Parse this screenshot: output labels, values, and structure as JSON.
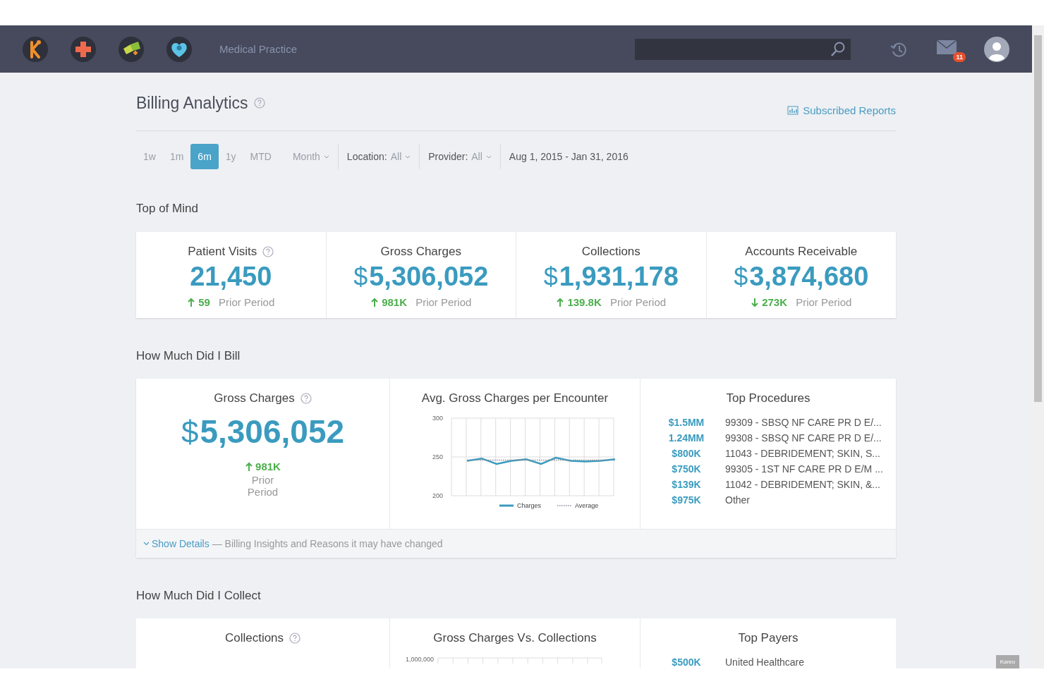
{
  "header": {
    "apps": [
      {
        "kind": "figure"
      },
      {
        "kind": "cross"
      },
      {
        "kind": "cards"
      },
      {
        "kind": "heart"
      }
    ],
    "practice": "Medical Practice",
    "mail_badge": "11"
  },
  "page": {
    "title": "Billing Analytics",
    "subscribed": "Subscribed Reports"
  },
  "filters": {
    "periods": [
      {
        "label": "1w",
        "selected": false
      },
      {
        "label": "1m",
        "selected": false
      },
      {
        "label": "6m",
        "selected": true
      },
      {
        "label": "1y",
        "selected": false
      },
      {
        "label": "MTD",
        "selected": false
      }
    ],
    "interval": "Month",
    "location": {
      "label": "Location:",
      "value": "All"
    },
    "provider": {
      "label": "Provider:",
      "value": "All"
    },
    "date_range": "Aug 1, 2015 - Jan 31, 2016"
  },
  "top_of_mind": {
    "title": "Top of Mind",
    "cards": [
      {
        "title": "Patient Visits",
        "help": true,
        "value": "21,450",
        "change": "59",
        "increase": true,
        "note": "Prior Period"
      },
      {
        "title": "Gross Charges",
        "help": false,
        "currency": "$",
        "value": "5,306,052",
        "change": "981K",
        "increase": true,
        "note": "Prior Period"
      },
      {
        "title": "Collections",
        "help": false,
        "currency": "$",
        "value": "1,931,178",
        "change": "139.8K",
        "increase": true,
        "note": "Prior Period"
      },
      {
        "title": "Accounts Receivable",
        "help": false,
        "currency": "$",
        "value": "3,874,680",
        "change": "273K",
        "increase": false,
        "note": "Prior Period"
      }
    ]
  },
  "bill": {
    "title": "How Much Did I Bill",
    "gross": {
      "title": "Gross Charges",
      "help": true,
      "currency": "$",
      "value": "5,306,052",
      "change": "981K",
      "increase": true,
      "note": "Prior Period"
    },
    "chart": {
      "title": "Avg. Gross Charges per Encounter",
      "chart_data": {
        "type": "line",
        "grid": true,
        "legend": true,
        "ylim": [
          200,
          300
        ],
        "yticks": [
          200,
          250,
          300
        ],
        "series": [
          {
            "name": "Charges",
            "color": "#3a9bbf",
            "line_style": "solid",
            "values": [
              245,
              248,
              241,
              245,
              247,
              241,
              249,
              245,
              244,
              245,
              247
            ]
          },
          {
            "name": "Average",
            "color": "#8a8f99",
            "line_style": "dotted",
            "values": [
              246,
              246,
              246,
              246,
              246,
              246,
              246,
              246,
              246,
              246,
              246
            ]
          }
        ]
      }
    },
    "procedures": {
      "title": "Top Procedures",
      "rows": [
        {
          "amount": "$1.5MM",
          "label": "99309 - SBSQ NF CARE PR D E/..."
        },
        {
          "amount": "1.24MM",
          "label": "99308 - SBSQ NF CARE PR D E/..."
        },
        {
          "amount": "$800K",
          "label": "11043 - DEBRIDEMENT; SKIN, S..."
        },
        {
          "amount": "$750K",
          "label": "99305 - 1ST NF CARE PR D E/M ..."
        },
        {
          "amount": "$139K",
          "label": "11042 - DEBRIDEMENT; SKIN, &..."
        },
        {
          "amount": "$975K",
          "label": "Other"
        }
      ]
    },
    "details_link": "Show Details",
    "details_text": "— Billing Insights and Reasons it may have changed"
  },
  "collect": {
    "title": "How Much Did I Collect",
    "collections_title": "Collections",
    "collections_help": true,
    "chart_title": "Gross Charges Vs. Collections",
    "chart_tick": "1,000,000",
    "payers_title": "Top Payers",
    "payers": [
      {
        "amount": "$500K",
        "label": "United Healthcare"
      }
    ]
  },
  "corner_badge": "Kareo"
}
